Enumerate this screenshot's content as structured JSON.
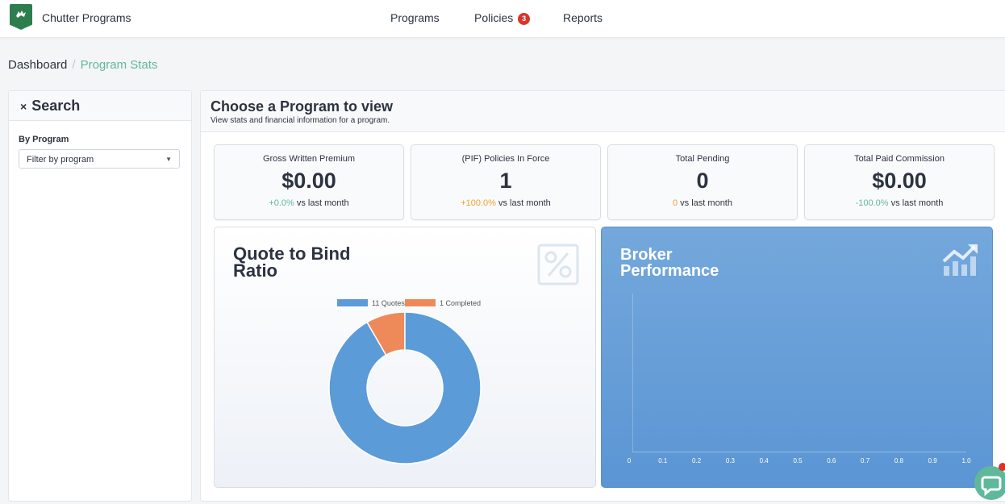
{
  "topbar": {
    "brand": "Chutter Programs",
    "nav": [
      {
        "label": "Programs"
      },
      {
        "label": "Policies",
        "badge": "3"
      },
      {
        "label": "Reports"
      }
    ]
  },
  "breadcrumb": {
    "home": "Dashboard",
    "separator": "/",
    "current": "Program Stats"
  },
  "sidebar": {
    "close": "×",
    "title": "Search",
    "filter_label": "By Program",
    "filter_value": "Filter by program"
  },
  "main": {
    "title": "Choose a Program to view",
    "subtitle": "View stats and financial information for a program."
  },
  "stats": [
    {
      "label": "Gross Written Premium",
      "value": "$0.00",
      "change": "+0.0%",
      "suffix": " vs last month"
    },
    {
      "label": "(PIF) Policies In Force",
      "value": "1",
      "change": "+100.0%",
      "suffix": " vs last month"
    },
    {
      "label": "Total Pending",
      "value": "0",
      "change": "0",
      "suffix": " vs last month"
    },
    {
      "label": "Total Paid Commission",
      "value": "$0.00",
      "change": "-100.0%",
      "suffix": " vs last month"
    }
  ],
  "quote_panel": {
    "title_line1": "Quote to Bind",
    "title_line2": "Ratio"
  },
  "broker_panel": {
    "title_line1": "Broker",
    "title_line2": "Performance",
    "x_ticks": [
      "0",
      "0.1",
      "0.2",
      "0.3",
      "0.4",
      "0.5",
      "0.6",
      "0.7",
      "0.8",
      "0.9",
      "1.0"
    ]
  },
  "chart_data": {
    "type": "pie",
    "categories": [
      "11 Quotes",
      "1 Completed"
    ],
    "values": [
      11,
      1
    ],
    "colors": [
      "#5b9bd8",
      "#ee8a59"
    ],
    "legend": "top"
  },
  "colors": {
    "accent": "#5fb89a",
    "badge": "#d9352b",
    "warn": "#f0a02e",
    "broker_bg": "#6ba3da"
  }
}
